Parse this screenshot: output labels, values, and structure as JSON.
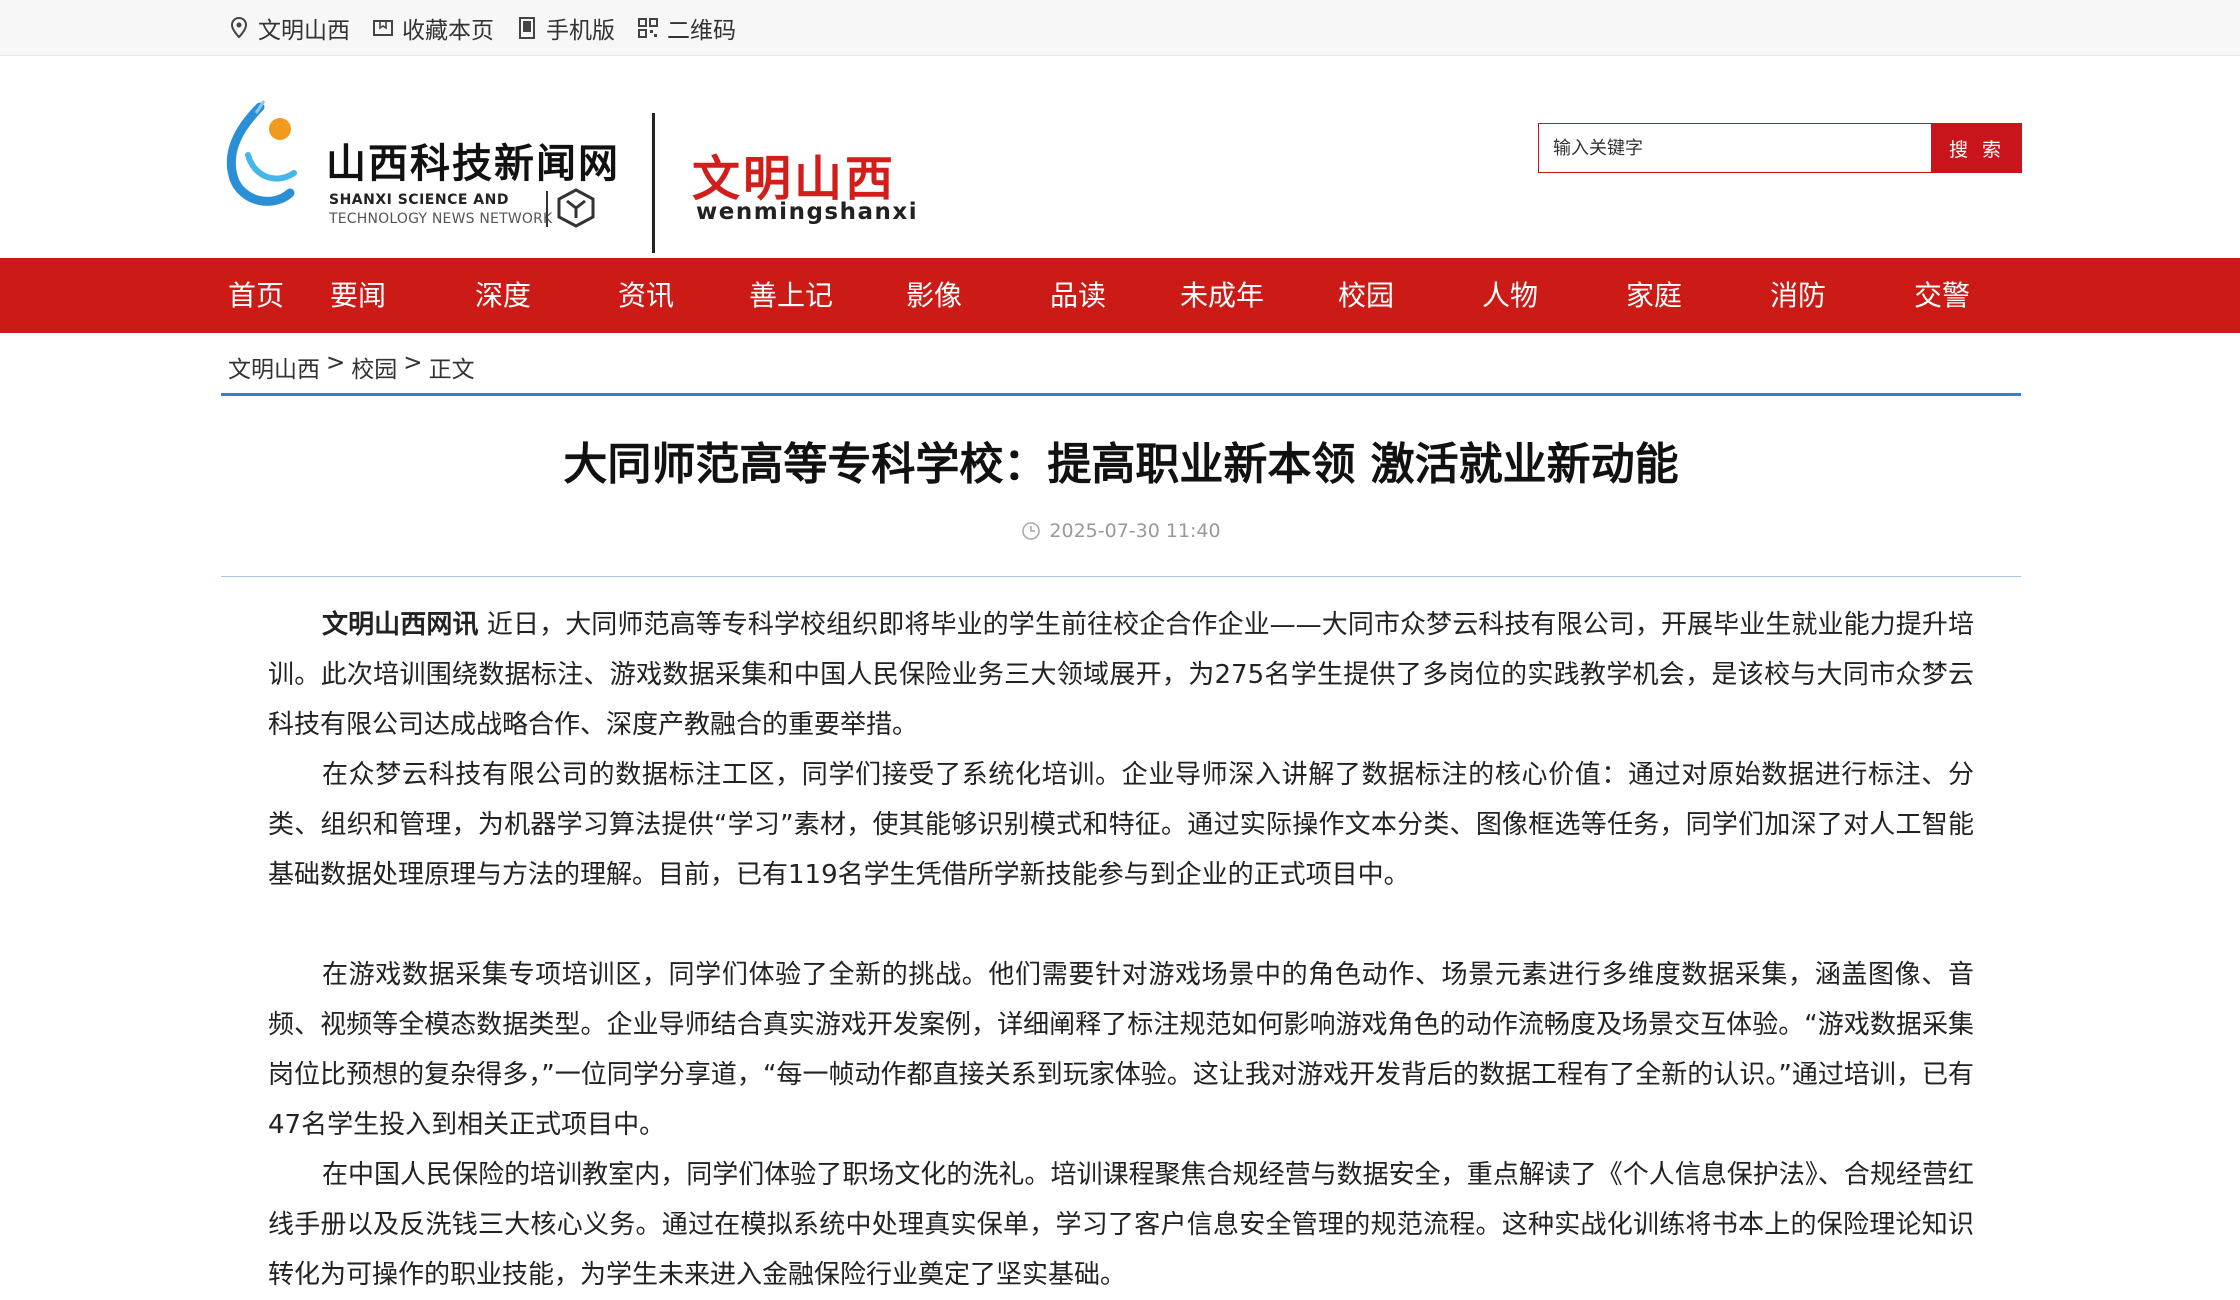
{
  "topbar": {
    "items": [
      {
        "label": "文明山西",
        "icon": "location-pin-icon"
      },
      {
        "label": "收藏本页",
        "icon": "bookmark-icon"
      },
      {
        "label": "手机版",
        "icon": "mobile-icon"
      },
      {
        "label": "二维码",
        "icon": "qr-code-icon"
      }
    ]
  },
  "header": {
    "logo_cn": "山西科技新闻网",
    "logo_en_line1": "SHANXI SCIENCE AND",
    "logo_en_line2": "TECHNOLOGY NEWS NETWORK",
    "brand_cn": "文明山西",
    "brand_en": "wenmingshanxi",
    "search_placeholder": "输入关键字",
    "search_button": "搜 索"
  },
  "colors": {
    "brand_red": "#cc1a16",
    "divider_blue": "#3b7cd1"
  },
  "nav": {
    "items": [
      "首页",
      "要闻",
      "深度",
      "资讯",
      "善上记",
      "影像",
      "品读",
      "未成年",
      "校园",
      "人物",
      "家庭",
      "消防",
      "交警"
    ]
  },
  "breadcrumb": {
    "items": [
      "文明山西",
      "校园",
      "正文"
    ],
    "separator": ">"
  },
  "article": {
    "title": "大同师范高等专科学校：提高职业新本领 激活就业新动能",
    "time": "2025-07-30 11:40",
    "lead": "文明山西网讯",
    "paragraphs": [
      "近日，大同师范高等专科学校组织即将毕业的学生前往校企合作企业——大同市众梦云科技有限公司，开展毕业生就业能力提升培训。此次培训围绕数据标注、游戏数据采集和中国人民保险业务三大领域展开，为275名学生提供了多岗位的实践教学机会，是该校与大同市众梦云科技有限公司达成战略合作、深度产教融合的重要举措。",
      "在众梦云科技有限公司的数据标注工区，同学们接受了系统化培训。企业导师深入讲解了数据标注的核心价值：通过对原始数据进行标注、分类、组织和管理，为机器学习算法提供“学习”素材，使其能够识别模式和特征。通过实际操作文本分类、图像框选等任务，同学们加深了对人工智能基础数据处理原理与方法的理解。目前，已有119名学生凭借所学新技能参与到企业的正式项目中。",
      "在游戏数据采集专项培训区，同学们体验了全新的挑战。他们需要针对游戏场景中的角色动作、场景元素进行多维度数据采集，涵盖图像、音频、视频等全模态数据类型。企业导师结合真实游戏开发案例，详细阐释了标注规范如何影响游戏角色的动作流畅度及场景交互体验。“游戏数据采集岗位比预想的复杂得多，”一位同学分享道，“每一帧动作都直接关系到玩家体验。这让我对游戏开发背后的数据工程有了全新的认识。”通过培训，已有47名学生投入到相关正式项目中。",
      "在中国人民保险的培训教室内，同学们体验了职场文化的洗礼。培训课程聚焦合规经营与数据安全，重点解读了《个人信息保护法》、合规经营红线手册以及反洗钱三大核心义务。通过在模拟系统中处理真实保单，学习了客户信息安全管理的规范流程。这种实战化训练将书本上的保险理论知识转化为可操作的职业技能，为学生未来进入金融保险行业奠定了坚实基础。"
    ]
  }
}
